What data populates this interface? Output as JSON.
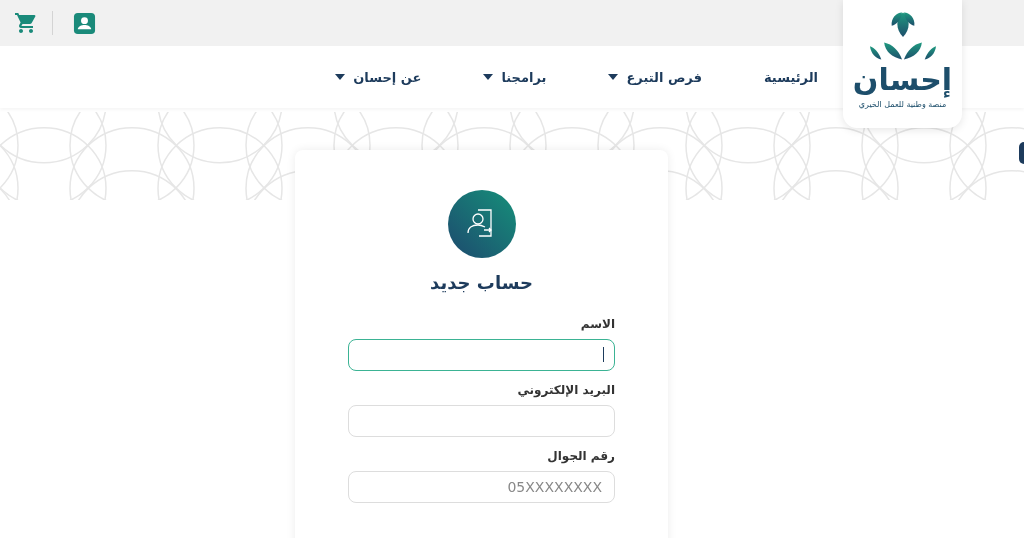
{
  "logo": {
    "name": "إحسان",
    "tagline": "منصة وطنية للعمل الخيري"
  },
  "nav": [
    {
      "label": "الرئيسية",
      "has_dropdown": false
    },
    {
      "label": "فرص التبرع",
      "has_dropdown": true
    },
    {
      "label": "برامجنا",
      "has_dropdown": true
    },
    {
      "label": "عن إحسان",
      "has_dropdown": true
    }
  ],
  "form": {
    "title": "حساب جديد",
    "fields": [
      {
        "label": "الاسم",
        "focused": true
      },
      {
        "label": "البريد الإلكتروني",
        "focused": false
      },
      {
        "label": "رقم الجوال",
        "placeholder": "05XXXXXXXX",
        "focused": false
      }
    ]
  }
}
